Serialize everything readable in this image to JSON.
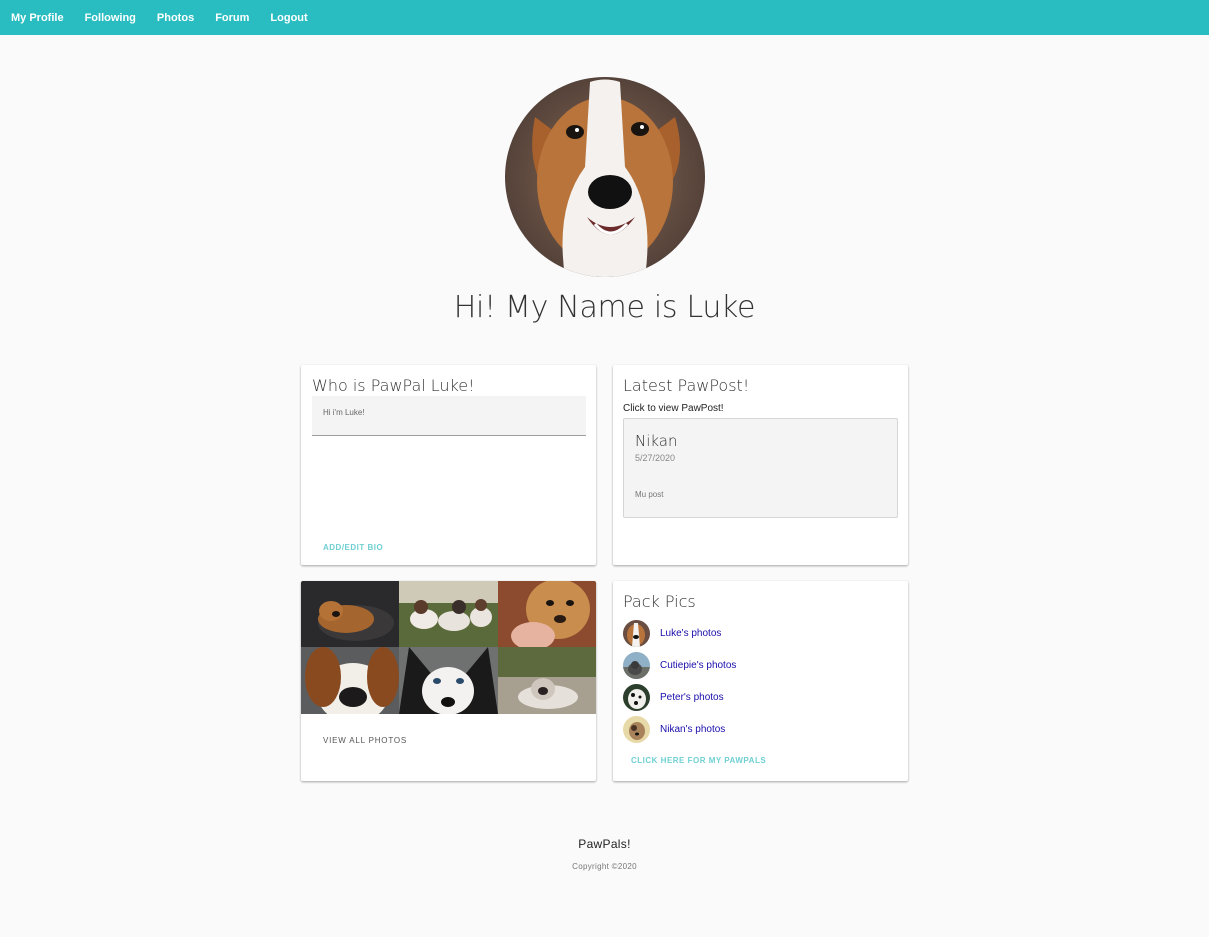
{
  "nav": {
    "items": [
      {
        "label": "My Profile"
      },
      {
        "label": "Following"
      },
      {
        "label": "Photos"
      },
      {
        "label": "Forum"
      },
      {
        "label": "Logout"
      }
    ]
  },
  "profile": {
    "greeting": "Hi! My Name is Luke"
  },
  "bio_card": {
    "title": "Who is PawPal Luke!",
    "bio_text": "Hi i'm Luke!",
    "action": "ADD/EDIT BIO"
  },
  "post_card": {
    "title": "Latest PawPost!",
    "hint": "Click to view PawPost!",
    "author": "Nikan",
    "date": "5/27/2020",
    "body": "Mu post"
  },
  "photos_card": {
    "action": "VIEW ALL PHOTOS"
  },
  "pack_card": {
    "title": "Pack Pics",
    "items": [
      {
        "label": "Luke's photos"
      },
      {
        "label": "Cutiepie's photos"
      },
      {
        "label": "Peter's photos"
      },
      {
        "label": "Nikan's photos"
      }
    ],
    "action": "CLICK HERE FOR MY PAWPALS"
  },
  "footer": {
    "title": "PawPals!",
    "copyright": "Copyright ©2020"
  },
  "colors": {
    "navbar": "#29bdc1",
    "accent_action": "#6fd0d3",
    "link": "#1a0dab",
    "background": "#fafafa"
  }
}
